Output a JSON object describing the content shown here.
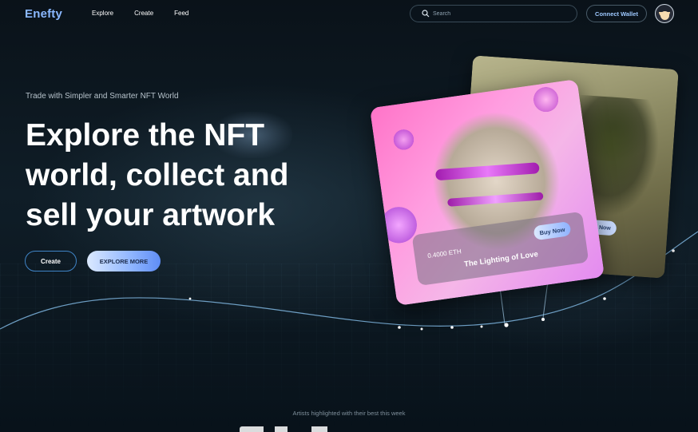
{
  "nav": {
    "logo": "Enefty",
    "links": [
      "Explore",
      "Create",
      "Feed"
    ],
    "search_placeholder": "Search",
    "connect_label": "Connect Wallet"
  },
  "hero": {
    "tagline": "Trade with Simpler and Smarter NFT World",
    "headline_line1": "Explore the NFT",
    "headline_line2": "world, collect and",
    "headline_line3": "sell your artwork",
    "create_label": "Create",
    "explore_label": "EXPLORE MORE"
  },
  "cards": {
    "front": {
      "price": "0.4000 ETH",
      "title": "The Lighting of Love",
      "buy_label": "Buy Now"
    },
    "back": {
      "buy_label": "Buy Now"
    }
  },
  "section": {
    "caption": "Artists highlighted with their best this week"
  },
  "colors": {
    "accent": "#8ab8ff",
    "background": "#0b1620",
    "create_border": "#3f84c6"
  }
}
